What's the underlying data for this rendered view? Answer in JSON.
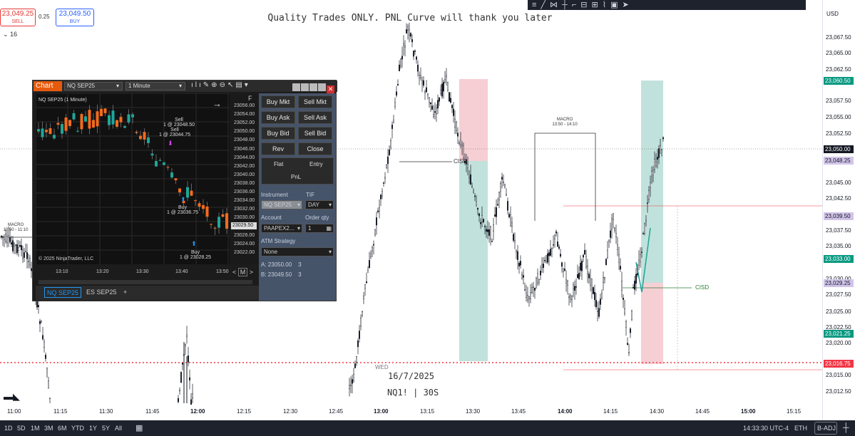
{
  "trade_widget": {
    "sell_price": "23,049.25",
    "sell_label": "SELL",
    "buy_price": "23,049.50",
    "buy_label": "BUY",
    "spread": "0.25",
    "quantity": "16"
  },
  "headline": "Quality Trades ONLY. PNL Curve will thank you later",
  "top_toolbar_icons": [
    "line-tool-icon",
    "trend-icon",
    "fib-icon",
    "crosshair-icon",
    "brush-icon",
    "text-icon",
    "measure-icon",
    "pattern-icon",
    "image-icon",
    "arrow-icon"
  ],
  "currency": "USD",
  "price_axis": {
    "ticks": [
      "23,067.50",
      "23,065.00",
      "23,062.50",
      "23,057.50",
      "23,055.00",
      "23,052.50",
      "23,045.00",
      "23,042.50",
      "23,037.50",
      "23,035.00",
      "23,030.00",
      "23,027.50",
      "23,025.00",
      "23,022.50",
      "23,020.00",
      "23,015.00",
      "23,012.50"
    ],
    "tags": [
      {
        "value": "23,060.50",
        "color": "#089981"
      },
      {
        "value": "23,050.00",
        "color": "#131722"
      },
      {
        "value": "23,048.25",
        "color": "#d1c4e9"
      },
      {
        "value": "23,039.50",
        "color": "#d1c4e9"
      },
      {
        "value": "23,033.00",
        "color": "#089981"
      },
      {
        "value": "23,029.25",
        "color": "#d1c4e9"
      },
      {
        "value": "23,021.25",
        "color": "#089981"
      },
      {
        "value": "23,016.75",
        "color": "#f23645"
      }
    ]
  },
  "time_axis": [
    "11:00",
    "11:15",
    "11:30",
    "11:45",
    "12:00",
    "12:15",
    "12:30",
    "12:45",
    "13:00",
    "13:15",
    "13:30",
    "13:45",
    "14:00",
    "14:15",
    "14:30",
    "14:45",
    "15:00",
    "15:15"
  ],
  "annotations": {
    "macro_left": "MACRO",
    "macro_left_time": "10:50 - 11:10",
    "macro_mid": "MACRO",
    "macro_mid_time": "13:50 - 14:10",
    "cisd_1": "CISD",
    "cisd_2": "CISD",
    "weekday": "WED",
    "date": "16/7/2025",
    "symbol": "NQ1! | 30S"
  },
  "bottom_bar": {
    "ranges": [
      "1D",
      "5D",
      "1M",
      "3M",
      "6M",
      "YTD",
      "1Y",
      "5Y",
      "All"
    ],
    "clock": "14:33:30 UTC-4",
    "session": "ETH",
    "adjust": "B-ADJ"
  },
  "ninjatrader": {
    "tab_label": "Chart",
    "instrument": "NQ SEP25",
    "interval": "1 Minute",
    "chart_title": "NQ SEP25 (1 Minute)",
    "copyright": "© 2025 NinjaTrader, LLC",
    "y_ticks": [
      "23056.00",
      "23054.00",
      "23052.00",
      "23050.00",
      "23048.00",
      "23046.00",
      "23044.00",
      "23042.00",
      "23040.00",
      "23038.00",
      "23036.00",
      "23034.00",
      "23032.00",
      "23030.00",
      "23028.00",
      "23026.00",
      "23024.00",
      "23022.00"
    ],
    "current_price": "23029.50",
    "x_ticks": [
      "13:10",
      "13:20",
      "13:30",
      "13:40",
      "13:50"
    ],
    "trades": [
      {
        "side": "Sell",
        "detail": "1 @ 23048.50"
      },
      {
        "side": "Sell",
        "detail": "1 @ 23044.75"
      },
      {
        "side": "Buy",
        "detail": "1 @ 23036.75"
      },
      {
        "side": "Buy",
        "detail": "1 @ 23028.25"
      }
    ],
    "buttons": {
      "buy_mkt": "Buy Mkt",
      "sell_mkt": "Sell Mkt",
      "buy_ask": "Buy Ask",
      "sell_ask": "Sell Ask",
      "buy_bid": "Buy Bid",
      "sell_bid": "Sell Bid",
      "rev": "Rev",
      "close": "Close",
      "flat": "Flat",
      "entry": "Entry",
      "pnl": "PnL"
    },
    "labels": {
      "instrument": "Instrument",
      "tif": "TIF",
      "account": "Account",
      "order_qty": "Order qty",
      "atm_strategy": "ATM Strategy"
    },
    "fields": {
      "instrument": "NQ SEP25",
      "tif": "DAY",
      "account": "PAAPEX2...",
      "order_qty": "1",
      "atm_strategy": "None"
    },
    "quotes": {
      "ask_label": "A:",
      "ask": "23050.00",
      "ask_size": "3",
      "bid_label": "B:",
      "bid": "23049.50",
      "bid_size": "3"
    },
    "tabs": [
      "NQ SEP25",
      "ES SEP25",
      "+"
    ],
    "f_label": "F",
    "m_label": "M"
  }
}
